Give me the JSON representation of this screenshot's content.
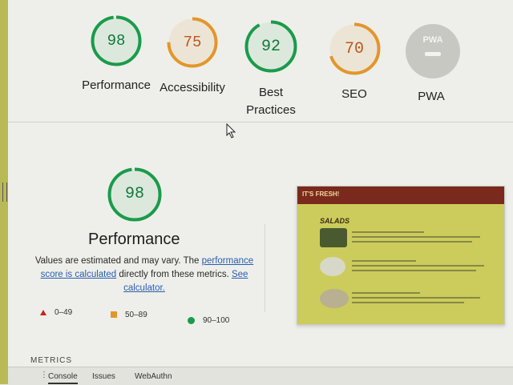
{
  "scores": [
    {
      "value": "98",
      "label": "Performance",
      "color": "#1a9b4b",
      "fraction": 0.98
    },
    {
      "value": "75",
      "label": "Accessibility",
      "color": "#e3962b",
      "fraction": 0.75
    },
    {
      "value": "92",
      "label": "Best Practices",
      "color": "#1a9b4b",
      "fraction": 0.92
    },
    {
      "value": "70",
      "label": "SEO",
      "color": "#e3962b",
      "fraction": 0.7
    }
  ],
  "pwa": {
    "badge": "PWA",
    "label": "PWA"
  },
  "detail": {
    "score": "98",
    "fraction": 0.98,
    "color": "#1a9b4b",
    "title": "Performance",
    "desc_part1": "Values are estimated and may vary. The ",
    "desc_link1": "performance score is calculated",
    "desc_part2": " directly from these metrics. ",
    "desc_link2": "See calculator."
  },
  "legend": [
    {
      "range": "0–49",
      "color": "#c7261c",
      "shape": "triangle"
    },
    {
      "range": "50–89",
      "color": "#e3962b",
      "shape": "square"
    },
    {
      "range": "90–100",
      "color": "#1a9b4b",
      "shape": "circle"
    }
  ],
  "thumbnail": {
    "banner": "IT'S FRESH!",
    "heading": "SALADS"
  },
  "metrics_label": "METRICS",
  "drawer": {
    "menu": "⋮",
    "tabs": [
      "Console",
      "Issues",
      "WebAuthn"
    ]
  }
}
